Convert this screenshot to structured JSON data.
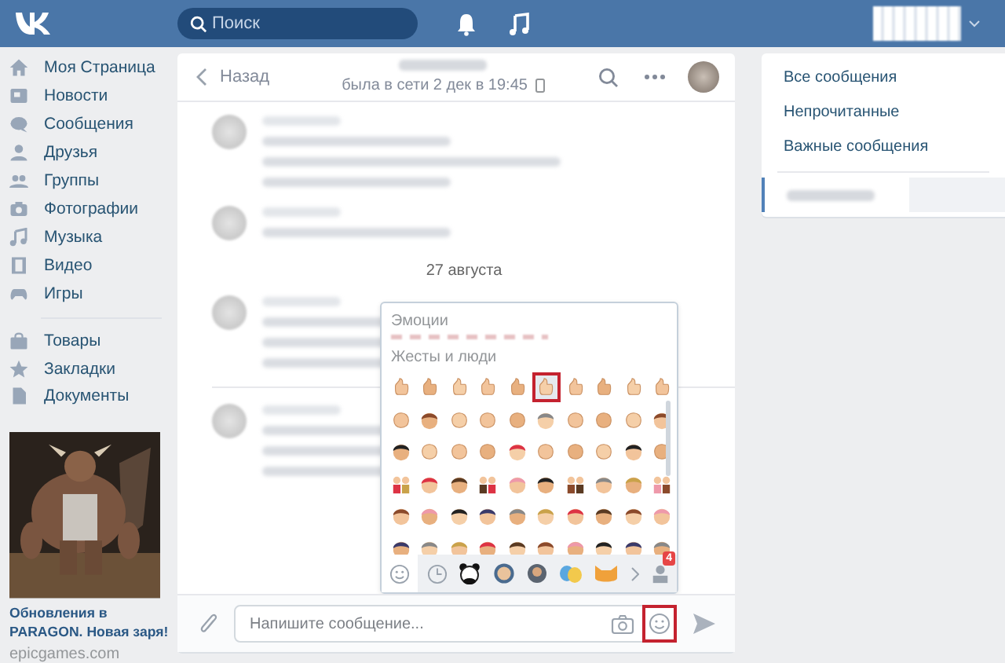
{
  "header": {
    "search": {
      "placeholder": "Поиск"
    }
  },
  "sidebar": {
    "items": [
      {
        "label": "Моя Страница"
      },
      {
        "label": "Новости"
      },
      {
        "label": "Сообщения"
      },
      {
        "label": "Друзья"
      },
      {
        "label": "Группы"
      },
      {
        "label": "Фотографии"
      },
      {
        "label": "Музыка"
      },
      {
        "label": "Видео"
      },
      {
        "label": "Игры"
      }
    ],
    "extra_items": [
      {
        "label": "Товары"
      },
      {
        "label": "Закладки"
      },
      {
        "label": "Документы"
      }
    ]
  },
  "ad": {
    "kind": "picture",
    "title": "Обновления в PARAGON. Новая заря!",
    "domain": "epicgames.com"
  },
  "chat": {
    "back": "Назад",
    "status": "была в сети 2 дек в 19:45",
    "date": "27 августа",
    "composer": {
      "placeholder": "Напишите сообщение...",
      "emoji_button_highlighted": true
    }
  },
  "emoji_panel": {
    "sections": [
      {
        "title": "Эмоции"
      },
      {
        "title": "Жесты и люди"
      }
    ],
    "first_row": [
      {
        "selected": false
      },
      {
        "selected": false
      },
      {
        "selected": false
      },
      {
        "selected": false
      },
      {
        "selected": false
      },
      {
        "selected": true
      },
      {
        "selected": false
      },
      {
        "selected": false
      },
      {
        "selected": false
      },
      {
        "selected": false
      }
    ],
    "badge": "4"
  },
  "filters": [
    {
      "label": "Все сообщения",
      "selected": false
    },
    {
      "label": "Непрочитанные",
      "selected": false
    },
    {
      "label": "Важные сообщения",
      "selected": false
    }
  ],
  "conversation": {
    "selected": true
  }
}
